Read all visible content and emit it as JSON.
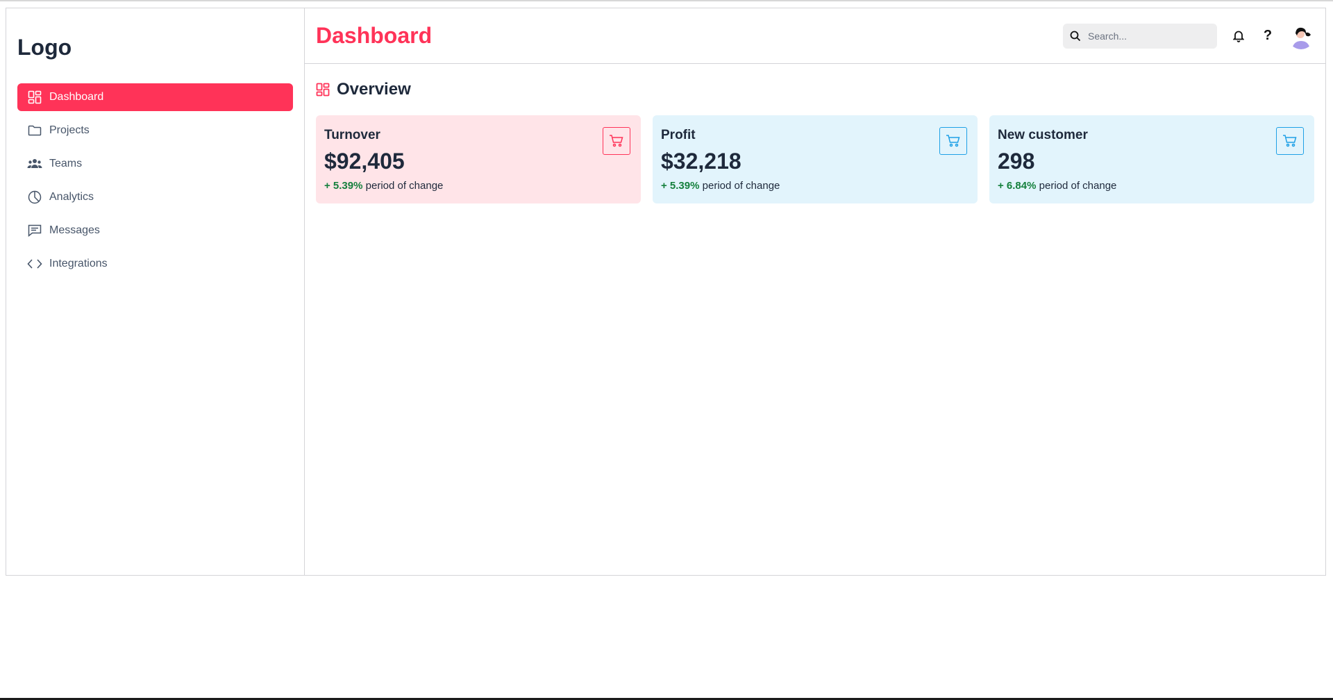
{
  "sidebar": {
    "logo": "Logo",
    "items": [
      {
        "label": "Dashboard",
        "icon": "dashboard-icon"
      },
      {
        "label": "Projects",
        "icon": "folder-icon"
      },
      {
        "label": "Teams",
        "icon": "users-icon"
      },
      {
        "label": "Analytics",
        "icon": "pie-chart-icon"
      },
      {
        "label": "Messages",
        "icon": "message-icon"
      },
      {
        "label": "Integrations",
        "icon": "code-icon"
      }
    ]
  },
  "header": {
    "title": "Dashboard",
    "search_placeholder": "Search...",
    "help_label": "?"
  },
  "overview": {
    "title": "Overview",
    "cards": [
      {
        "label": "Turnover",
        "value": "$92,405",
        "change_pct": "+ 5.39%",
        "change_text": " period of change"
      },
      {
        "label": "Profit",
        "value": "$32,218",
        "change_pct": "+ 5.39%",
        "change_text": " period of change"
      },
      {
        "label": "New customer",
        "value": "298",
        "change_pct": "+ 6.84%",
        "change_text": " period of change"
      }
    ]
  },
  "colors": {
    "accent": "#ff3358",
    "card_pink": "#ffe4e8",
    "card_blue": "#e2f4fc",
    "positive": "#15803d",
    "blue_icon": "#1ea0e6"
  }
}
